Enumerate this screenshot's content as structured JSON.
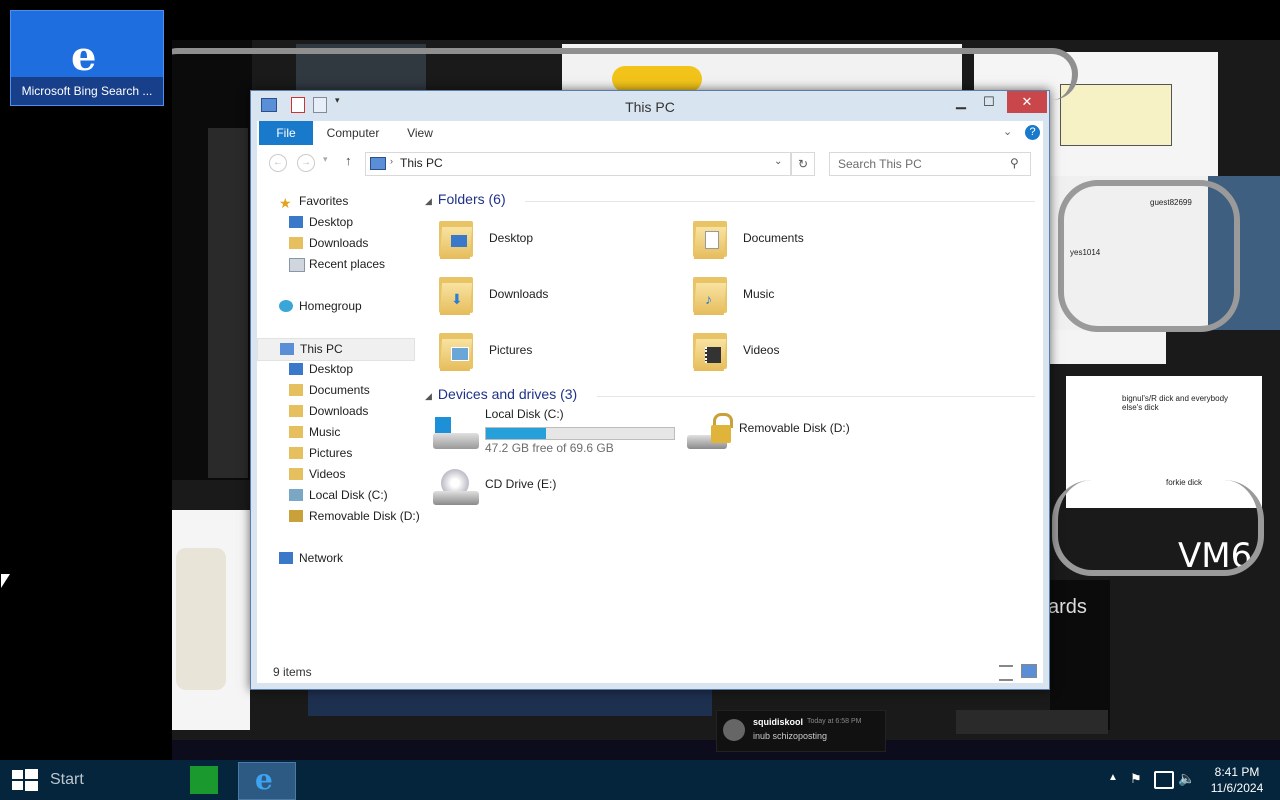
{
  "desktop": {
    "bing_tile_label": "Microsoft Bing Search ..."
  },
  "explorer": {
    "title": "This PC",
    "ribbon_tabs": [
      "File",
      "Computer",
      "View"
    ],
    "address": "This PC",
    "search_placeholder": "Search This PC",
    "nav": {
      "favorites": "Favorites",
      "fav_items": [
        "Desktop",
        "Downloads",
        "Recent places"
      ],
      "homegroup": "Homegroup",
      "thispc": "This PC",
      "pc_items": [
        "Desktop",
        "Documents",
        "Downloads",
        "Music",
        "Pictures",
        "Videos",
        "Local Disk (C:)",
        "Removable Disk (D:)"
      ],
      "network": "Network"
    },
    "folders_header": "Folders (6)",
    "folders": [
      "Desktop",
      "Documents",
      "Downloads",
      "Music",
      "Pictures",
      "Videos"
    ],
    "devices_header": "Devices and drives (3)",
    "drives": {
      "c_name": "Local Disk (C:)",
      "c_free": "47.2 GB free of 69.6 GB",
      "c_used_fraction": 0.32,
      "d_name": "Removable Disk (D:)",
      "e_name": "CD Drive (E:)"
    },
    "status": "9 items"
  },
  "taskbar": {
    "start_label": "Start",
    "time": "8:41 PM",
    "date": "11/6/2024"
  },
  "wallpaper_text": {
    "vm_label": "VM6",
    "chat_user": "squidiskool",
    "chat_time": "Today at 6:58 PM",
    "chat_msg": "inub schizoposting",
    "note_big": "bignul's/R dick and everybody else's dick",
    "note_small": "forkie dick",
    "cards": "ards",
    "drawing_user": "guest82699",
    "drawing_user2": "yes1014"
  },
  "colors": {
    "accent": "#1979ca",
    "taskbar": "#04253c",
    "close": "#c9474b",
    "progress": "#26a0da"
  }
}
